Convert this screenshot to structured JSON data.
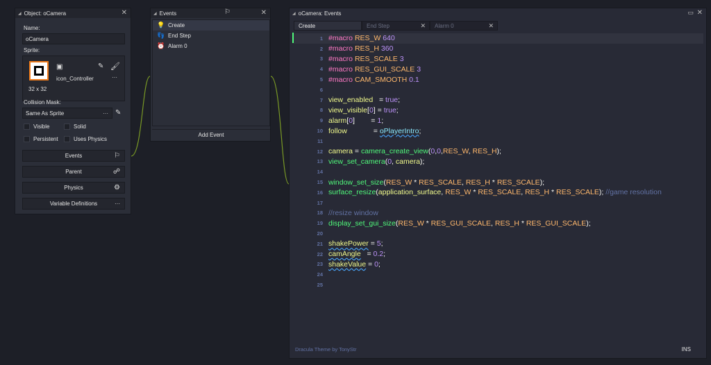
{
  "object_panel": {
    "title": "Object: oCamera",
    "name_label": "Name:",
    "name_value": "oCamera",
    "sprite_label": "Sprite:",
    "sprite_name": "icon_Controller",
    "sprite_size": "32 x 32",
    "sprite_more": "···",
    "collision_label": "Collision Mask:",
    "collision_value": "Same As Sprite",
    "collision_more": "···",
    "visible_label": "Visible",
    "solid_label": "Solid",
    "persistent_label": "Persistent",
    "physics_check_label": "Uses Physics",
    "buttons": {
      "events": "Events",
      "parent": "Parent",
      "physics": "Physics",
      "variables": "Variable Definitions",
      "variables_more": "···"
    }
  },
  "events_panel": {
    "title": "Events",
    "items": [
      {
        "label": "Create",
        "icon": "lightbulb-icon"
      },
      {
        "label": "End Step",
        "icon": "footsteps-icon"
      },
      {
        "label": "Alarm 0",
        "icon": "alarm-clock-icon"
      }
    ],
    "add_event": "Add Event"
  },
  "editor": {
    "title": "oCamera: Events",
    "tabs": [
      "Create",
      "End Step",
      "Alarm 0"
    ],
    "status_left": "Dracula Theme by TonyStr",
    "status_right": "INS",
    "line_numbers": [
      "1",
      "2",
      "3",
      "4",
      "5",
      "6",
      "7",
      "8",
      "9",
      "10",
      "11",
      "12",
      "13",
      "14",
      "15",
      "16",
      "17",
      "18",
      "19",
      "20",
      "21",
      "22",
      "23",
      "24",
      "25"
    ]
  },
  "colors": {
    "keyword": "#ff79c6",
    "macro": "#ffb86c",
    "number": "#bd93f9",
    "builtin_var": "#8be9fd",
    "function": "#50fa7b",
    "comment": "#6272a4",
    "sprite_border": "#f07b1a"
  }
}
